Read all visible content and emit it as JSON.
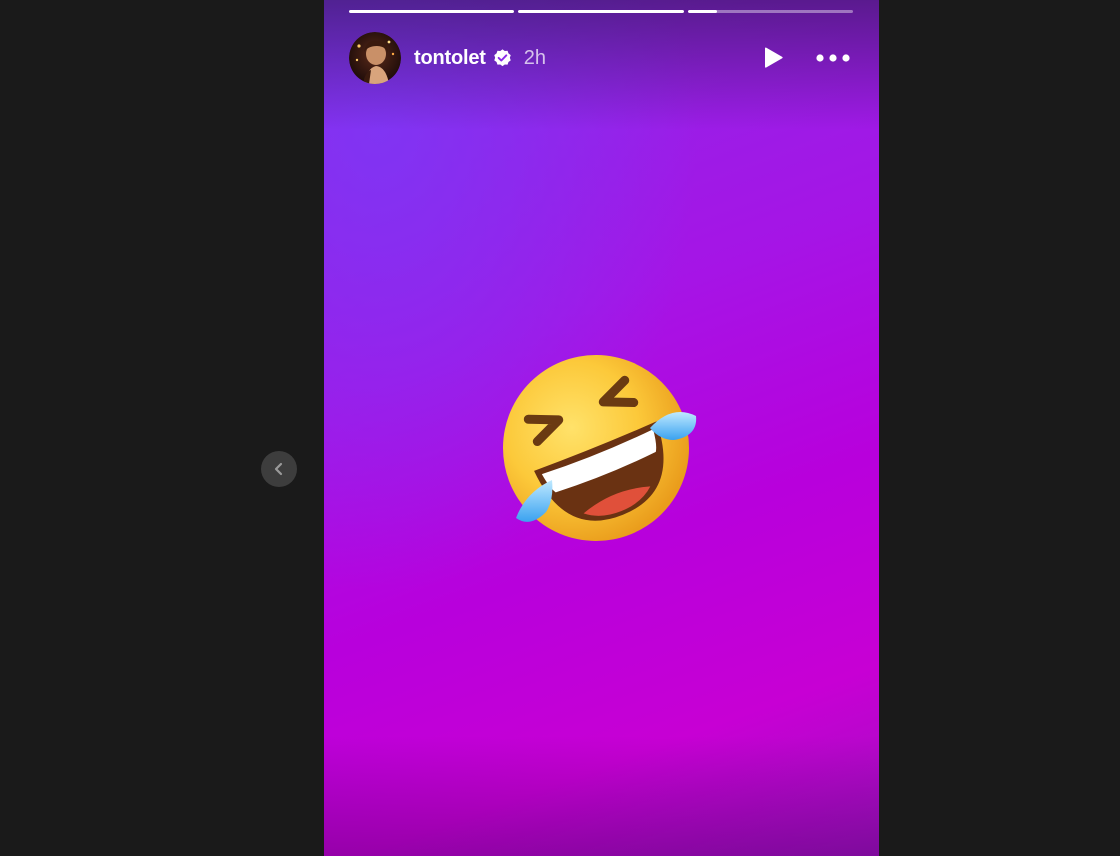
{
  "story": {
    "username": "tontolet",
    "verified": true,
    "time_ago": "2h",
    "progress_segments": [
      {
        "progress": 1.0
      },
      {
        "progress": 1.0
      },
      {
        "progress": 0.18
      }
    ],
    "content_emoji": "rolling-on-the-floor-laughing",
    "background_colors": [
      "#8a2be8",
      "#b800dc",
      "#c700d4"
    ]
  },
  "controls": {
    "play_icon": "play-icon",
    "more_icon": "more-horizontal-icon",
    "prev_icon": "chevron-left-icon"
  },
  "colors": {
    "page_background": "#1a1a1a",
    "prev_button_bg": "#3d3d3d",
    "verified_badge": "#ffffff"
  }
}
